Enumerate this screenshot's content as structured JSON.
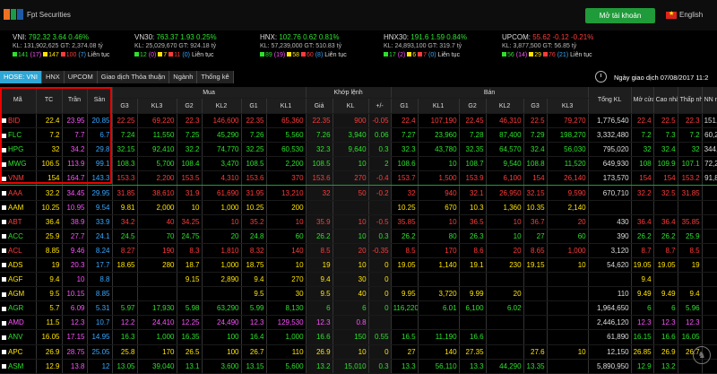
{
  "header": {
    "logo_text": "Fpt Securities",
    "open_account": "Mở tài khoản",
    "language": "English"
  },
  "indices": [
    {
      "name": "VNI:",
      "value": "792.32",
      "change": "3.64 0.46%",
      "kl": "KL: 131,902,625 GT: 2,374.08 tỷ",
      "up": "141",
      "ceil": "17",
      "flat": "147",
      "down": "100",
      "floor": "7",
      "status": "Liên tục",
      "dir": "up"
    },
    {
      "name": "VN30:",
      "value": "763.37",
      "change": "1.93 0.25%",
      "kl": "KL: 25,029,670 GT: 924.18 tỷ",
      "up": "12",
      "ceil": "0",
      "flat": "7",
      "down": "11",
      "floor": "0",
      "status": "Liên tục",
      "dir": "up"
    },
    {
      "name": "HNX:",
      "value": "102.76",
      "change": "0.62 0.81%",
      "kl": "KL: 57,239,000 GT: 510.83 tỷ",
      "up": "89",
      "ceil": "19",
      "flat": "58",
      "down": "60",
      "floor": "8",
      "status": "Liên tục",
      "dir": "up"
    },
    {
      "name": "HNX30:",
      "value": "191.6",
      "change": "1.59 0.84%",
      "kl": "KL: 24,893,100 GT: 319.7 tỷ",
      "up": "17",
      "ceil": "2",
      "flat": "6",
      "down": "7",
      "floor": "0",
      "status": "Liên tục",
      "dir": "up"
    },
    {
      "name": "UPCOM:",
      "value": "55.62",
      "change": "-0.12 -0.21%",
      "kl": "KL: 3,877,500 GT: 56.85 tỷ",
      "up": "56",
      "ceil": "14",
      "flat": "29",
      "down": "76",
      "floor": "21",
      "status": "Liên tục",
      "dir": "down"
    }
  ],
  "tabs": [
    "HOSE: VNI",
    "HNX",
    "UPCOM",
    "Giao dịch Thỏa thuận",
    "Ngành",
    "Thống kê"
  ],
  "trade_date": "Ngày giao dịch 07/08/2017 11:2",
  "columns": {
    "group_buy": "Mua",
    "group_match": "Khớp lệnh",
    "group_sell": "Bán",
    "sym": "Mã",
    "ref": "TC",
    "ceil": "Trần",
    "floor": "Sàn",
    "g3": "G3",
    "kl3": "KL3",
    "g2": "G2",
    "kl2": "KL2",
    "g1": "G1",
    "kl1": "KL1",
    "price": "Giá",
    "vol": "KL",
    "chg": "+/-",
    "total": "Tổng KL",
    "open": "Mở cửa",
    "high": "Cao nhất",
    "low": "Thấp nhất",
    "nn": "NN mua"
  },
  "rows": [
    {
      "s": "BID",
      "t": "22.4",
      "c": "23.95",
      "f": "20.85",
      "b3": "22.25",
      "v3": "69,220",
      "b2": "22.3",
      "v2": "146,600",
      "b1": "22.35",
      "v1": "65,360",
      "p": "22.35",
      "v": "900",
      "d": "-0.05",
      "a1": "22.4",
      "w1": "107,190",
      "a2": "22.45",
      "w2": "46,310",
      "a3": "22.5",
      "w3": "79,270",
      "tk": "1,776,540",
      "o": "22.4",
      "h": "22.5",
      "l": "22.3",
      "n": "151,000",
      "cl": "r"
    },
    {
      "s": "FLC",
      "t": "7.2",
      "c": "7.7",
      "f": "6.7",
      "b3": "7.24",
      "v3": "11,550",
      "b2": "7.25",
      "v2": "45,290",
      "b1": "7.26",
      "v1": "5,560",
      "p": "7.26",
      "v": "3,940",
      "d": "0.06",
      "a1": "7.27",
      "w1": "23,960",
      "a2": "7.28",
      "w2": "87,400",
      "a3": "7.29",
      "w3": "198,270",
      "tk": "3,332,480",
      "o": "7.2",
      "h": "7.3",
      "l": "7.2",
      "n": "60,210",
      "cl": "g"
    },
    {
      "s": "HPG",
      "t": "32",
      "c": "34.2",
      "f": "29.8",
      "b3": "32.15",
      "v3": "92,410",
      "b2": "32.2",
      "v2": "74,770",
      "b1": "32.25",
      "v1": "60,530",
      "p": "32.3",
      "v": "9,640",
      "d": "0.3",
      "a1": "32.3",
      "w1": "43,780",
      "a2": "32.35",
      "w2": "64,570",
      "a3": "32.4",
      "w3": "56,030",
      "tk": "795,020",
      "o": "32",
      "h": "32.4",
      "l": "32",
      "n": "344,860",
      "cl": "g"
    },
    {
      "s": "MWG",
      "t": "106.5",
      "c": "113.9",
      "f": "99.1",
      "b3": "108.3",
      "v3": "5,700",
      "b2": "108.4",
      "v2": "3,470",
      "b1": "108.5",
      "v1": "2,200",
      "p": "108.5",
      "v": "10",
      "d": "2",
      "a1": "108.6",
      "w1": "10",
      "a2": "108.7",
      "w2": "9,540",
      "a3": "108.8",
      "w3": "11,520",
      "tk": "649,930",
      "o": "108",
      "h": "109.9",
      "l": "107.1",
      "n": "72,240",
      "cl": "g"
    },
    {
      "s": "VNM",
      "t": "154",
      "c": "164.7",
      "f": "143.3",
      "b3": "153.3",
      "v3": "2,200",
      "b2": "153.5",
      "v2": "4,310",
      "b1": "153.6",
      "v1": "370",
      "p": "153.6",
      "v": "270",
      "d": "-0.4",
      "a1": "153.7",
      "w1": "1,500",
      "a2": "153.9",
      "w2": "6,100",
      "a3": "154",
      "w3": "26,140",
      "tk": "173,570",
      "o": "154",
      "h": "154",
      "l": "153.2",
      "n": "91,820",
      "cl": "r"
    },
    {
      "s": "AAA",
      "t": "32.2",
      "c": "34.45",
      "f": "29.95",
      "b3": "31.85",
      "v3": "38,610",
      "b2": "31.9",
      "v2": "61,690",
      "b1": "31.95",
      "v1": "13,210",
      "p": "32",
      "v": "50",
      "d": "-0.2",
      "a1": "32",
      "w1": "940",
      "a2": "32.1",
      "w2": "26,950",
      "a3": "32.15",
      "w3": "9,590",
      "tk": "670,710",
      "o": "32.2",
      "h": "32.5",
      "l": "31.85",
      "n": "",
      "cl": "r"
    },
    {
      "s": "AAM",
      "t": "10.25",
      "c": "10.95",
      "f": "9.54",
      "b3": "9.81",
      "v3": "2,000",
      "b2": "10",
      "v2": "1,000",
      "b1": "10.25",
      "v1": "200",
      "p": "",
      "v": "",
      "d": "",
      "a1": "10.25",
      "w1": "670",
      "a2": "10.3",
      "w2": "1,360",
      "a3": "10.35",
      "w3": "2,140",
      "tk": "",
      "o": "",
      "h": "",
      "l": "",
      "n": "",
      "cl": "y"
    },
    {
      "s": "ABT",
      "t": "36.4",
      "c": "38.9",
      "f": "33.9",
      "b3": "34.2",
      "v3": "40",
      "b2": "34.25",
      "v2": "10",
      "b1": "35.2",
      "v1": "10",
      "p": "35.9",
      "v": "10",
      "d": "-0.5",
      "a1": "35.85",
      "w1": "10",
      "a2": "36.5",
      "w2": "10",
      "a3": "36.7",
      "w3": "20",
      "tk": "430",
      "o": "36.4",
      "h": "36.4",
      "l": "35.85",
      "n": "",
      "cl": "r"
    },
    {
      "s": "ACC",
      "t": "25.9",
      "c": "27.7",
      "f": "24.1",
      "b3": "24.5",
      "v3": "70",
      "b2": "24.75",
      "v2": "20",
      "b1": "24.8",
      "v1": "60",
      "p": "26.2",
      "v": "10",
      "d": "0.3",
      "a1": "26.2",
      "w1": "80",
      "a2": "26.3",
      "w2": "10",
      "a3": "27",
      "w3": "60",
      "tk": "390",
      "o": "26.2",
      "h": "26.2",
      "l": "25.9",
      "n": "",
      "cl": "g"
    },
    {
      "s": "ACL",
      "t": "8.85",
      "c": "9.46",
      "f": "8.24",
      "b3": "8.27",
      "v3": "190",
      "b2": "8.3",
      "v2": "1,810",
      "b1": "8.32",
      "v1": "140",
      "p": "8.5",
      "v": "20",
      "d": "-0.35",
      "a1": "8.5",
      "w1": "170",
      "a2": "8.6",
      "w2": "20",
      "a3": "8.65",
      "w3": "1,000",
      "tk": "3,120",
      "o": "8.7",
      "h": "8.7",
      "l": "8.5",
      "n": "",
      "cl": "r"
    },
    {
      "s": "ADS",
      "t": "19",
      "c": "20.3",
      "f": "17.7",
      "b3": "18.65",
      "v3": "280",
      "b2": "18.7",
      "v2": "1,000",
      "b1": "18.75",
      "v1": "10",
      "p": "19",
      "v": "10",
      "d": "0",
      "a1": "19.05",
      "w1": "1,140",
      "a2": "19.1",
      "w2": "230",
      "a3": "19.15",
      "w3": "10",
      "tk": "54,620",
      "o": "19.05",
      "h": "19.05",
      "l": "19",
      "n": "",
      "cl": "y"
    },
    {
      "s": "AGF",
      "t": "9.4",
      "c": "10",
      "f": "8.8",
      "b3": "",
      "v3": "",
      "b2": "9.15",
      "v2": "2,890",
      "b1": "9.4",
      "v1": "270",
      "p": "9.4",
      "v": "30",
      "d": "0",
      "a1": "",
      "w1": "",
      "a2": "",
      "w2": "",
      "a3": "",
      "w3": "",
      "tk": "",
      "o": "9.4",
      "h": "",
      "l": "",
      "n": "",
      "cl": "y"
    },
    {
      "s": "AGM",
      "t": "9.5",
      "c": "10.15",
      "f": "8.85",
      "b3": "",
      "v3": "",
      "b2": "",
      "v2": "",
      "b1": "9.5",
      "v1": "30",
      "p": "9.5",
      "v": "40",
      "d": "0",
      "a1": "9.95",
      "w1": "3,720",
      "a2": "9.99",
      "w2": "20",
      "a3": "",
      "w3": "",
      "tk": "110",
      "o": "9.49",
      "h": "9.49",
      "l": "9.4",
      "n": "",
      "cl": "y"
    },
    {
      "s": "AGR",
      "t": "5.7",
      "c": "6.09",
      "f": "5.31",
      "b3": "5.97",
      "v3": "17,930",
      "b2": "5.98",
      "v2": "63,290",
      "b1": "5.99",
      "v1": "8,130",
      "p": "6",
      "v": "6",
      "d": "0",
      "a1": "116,220",
      "w1": "6.01",
      "a2": "6,100",
      "w2": "6.02",
      "a3": "",
      "w3": "",
      "tk": "1,964,650",
      "o": "6",
      "h": "6",
      "l": "5.96",
      "n": "",
      "cl": "g"
    },
    {
      "s": "AMD",
      "t": "11.5",
      "c": "12.3",
      "f": "10.7",
      "b3": "12.2",
      "v3": "24,410",
      "b2": "12.25",
      "v2": "24,490",
      "b1": "12.3",
      "v1": "129,530",
      "p": "12.3",
      "v": "0.8",
      "d": "",
      "a1": "",
      "w1": "",
      "a2": "",
      "w2": "",
      "a3": "",
      "w3": "",
      "tk": "2,446,120",
      "o": "12.3",
      "h": "12.3",
      "l": "12.3",
      "n": "",
      "cl": "p"
    },
    {
      "s": "ANV",
      "t": "16.05",
      "c": "17.15",
      "f": "14.95",
      "b3": "16.3",
      "v3": "1,000",
      "b2": "16.35",
      "v2": "100",
      "b1": "16.4",
      "v1": "1,000",
      "p": "16.6",
      "v": "150",
      "d": "0.55",
      "a1": "16.5",
      "w1": "11,190",
      "a2": "16.6",
      "w2": "",
      "a3": "",
      "w3": "",
      "tk": "61,890",
      "o": "16.15",
      "h": "16.6",
      "l": "16.05",
      "n": "",
      "cl": "g"
    },
    {
      "s": "APC",
      "t": "26.9",
      "c": "28.75",
      "f": "25.05",
      "b3": "25.8",
      "v3": "170",
      "b2": "26.5",
      "v2": "100",
      "b1": "26.7",
      "v1": "110",
      "p": "26.9",
      "v": "10",
      "d": "0",
      "a1": "27",
      "w1": "140",
      "a2": "27.35",
      "w2": "",
      "a3": "27.6",
      "w3": "10",
      "tk": "12,150",
      "o": "26.85",
      "h": "26.9",
      "l": "26.7",
      "n": "",
      "cl": "y"
    },
    {
      "s": "ASM",
      "t": "12.9",
      "c": "13.8",
      "f": "12",
      "b3": "13.05",
      "v3": "39,040",
      "b2": "13.1",
      "v2": "3,600",
      "b1": "13.15",
      "v1": "5,600",
      "p": "13.2",
      "v": "15,010",
      "d": "0.3",
      "a1": "13.3",
      "w1": "56,110",
      "a2": "13.3",
      "w2": "44,290",
      "a3": "13.35",
      "w3": "",
      "tk": "5,890,950",
      "o": "12.9",
      "h": "13.2",
      "l": "",
      "n": "",
      "cl": "g"
    }
  ]
}
